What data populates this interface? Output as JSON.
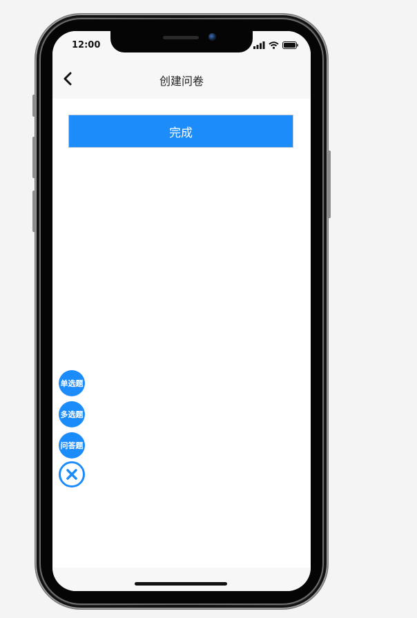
{
  "statusbar": {
    "time": "12:00"
  },
  "navbar": {
    "back_icon": "chevron-left-icon",
    "title": "创建问卷"
  },
  "main": {
    "done_label": "完成"
  },
  "fab_menu": {
    "items": [
      {
        "label": "单选题"
      },
      {
        "label": "多选题"
      },
      {
        "label": "问答题"
      }
    ],
    "close_icon": "close-icon"
  },
  "colors": {
    "accent": "#1b8cfa",
    "bar_bg": "#f7f7f7"
  }
}
